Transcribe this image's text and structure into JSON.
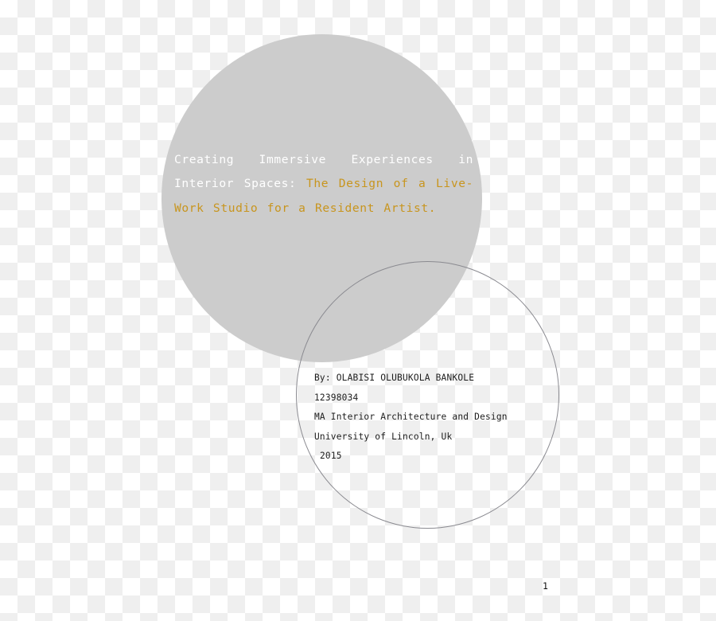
{
  "document": {
    "kind": "dissertation-title-page",
    "page_number": "1"
  },
  "colors": {
    "disc_fill": "#cccccc",
    "outline_stroke": "#8a8a90",
    "title_plain": "#ffffff",
    "title_accent": "#c8951e",
    "body_text": "#1d1d1d",
    "checker_light": "#ffffff",
    "checker_dark": "#efefef"
  },
  "title": {
    "plain_part": "Creating Immersive Experiences in Interior Spaces: ",
    "accent_part": "The Design of a Live-Work Studio for a Resident Artist.",
    "full": "Creating Immersive Experiences in Interior Spaces: The Design of a Live-Work Studio for a Resident Artist."
  },
  "author": {
    "lines": [
      {
        "text": "By: OLABISI OLUBUKOLA BANKOLE",
        "indent": false
      },
      {
        "text": "12398034",
        "indent": false
      },
      {
        "text": "MA Interior Architecture and Design",
        "indent": false
      },
      {
        "text": "University of Lincoln, Uk",
        "indent": false
      },
      {
        "text": "2015",
        "indent": true
      }
    ],
    "byline": "By: OLABISI OLUBUKOLA BANKOLE",
    "student_id": "12398034",
    "programme": "MA Interior Architecture and Design",
    "institution": "University of Lincoln, Uk",
    "year": "2015"
  },
  "shapes": {
    "grey_disc_name": "grey-filled-circle",
    "outline_circle_name": "grey-outlined-circle"
  }
}
